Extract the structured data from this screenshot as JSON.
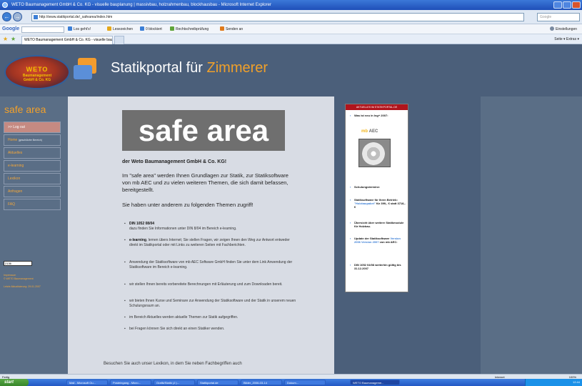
{
  "window": {
    "title": "WETO Baumanagement GmbH & Co. KG - visuelle bauplanung | massivbau, holzrahmenbau, blockhausbau - Microsoft Internet Explorer"
  },
  "browser": {
    "url": "http://www.statikportal.de/_safearea/index.htm",
    "search_placeholder": "Google",
    "tab_title": "WETO Baumanagement GmbH & Co. KG - visuelle bau...",
    "tab_commands": "Seite ▾   Extras ▾",
    "google_logo": "Google",
    "google_items": [
      "Los geht's!",
      "Lesezeichen",
      "0 blockiert",
      "Rechtschreibprüfung",
      "Senden an"
    ],
    "google_settings": "Einstellungen",
    "status_left": "Fertig",
    "status_zone": "Internet",
    "status_zoom": "100%"
  },
  "site": {
    "logo_main": "WETO",
    "logo_sub1": "Baumanagement",
    "logo_sub2": "GmbH & Co. KG",
    "title_prefix": "Statikportal für",
    "title_accent": "Zimmerer",
    "accent_color": "#f0a02a"
  },
  "sidebar": {
    "title": "safe area",
    "items": [
      {
        "label": ">> Log out"
      },
      {
        "label": "Home",
        "note": "(geschützter Bereich)"
      },
      {
        "label": "Aktuelles"
      },
      {
        "label": "e-learning"
      },
      {
        "label": "Lexikon"
      },
      {
        "label": "Anfragen"
      },
      {
        "label": "FAQ"
      }
    ],
    "field_value": "2136",
    "note1": "Impressum",
    "note2": "© WETO Baumanagement",
    "note3": "Letzte Aktualisierung: 29.01.2007"
  },
  "content": {
    "banner": "safe area",
    "company": "der Weto Baumanagement GmbH & Co. KG!",
    "intro": "Im \"safe area\" werden Ihnen Grundlagen zur Statik, zur Statiksoftware von mb AEC und zu vielen weiteren Themen, die sich damit befassen, bereitgestellt.",
    "lead": "Sie haben unter anderem zu folgenden Themen zugriff!",
    "bullets": [
      {
        "strong": "DIN 1052 08/04",
        "text": "dazu finden Sie Informationen unter DIN 8/04 im Bereich e-learning."
      },
      {
        "strong": "e-learning",
        "text": ", lernen übers Internet; Sie stellen Fragen, wir zeigen Ihnen den Weg zur Antwort entweder direkt im Statikportal oder mit Links zu weiteren Seiten mit Fachberichten."
      },
      {
        "strong": "",
        "text": "Anwendung der Statiksoftware von mb AEC Software GmbH finden Sie unter dem Link Anwendung der Statiksoftware im Bereich e-learning."
      },
      {
        "strong": "",
        "text": "wir stellen Ihnen bereits vorbereitete Berechnungen mit Erläuterung und zum Downloaden bereit."
      },
      {
        "strong": "",
        "text": "wir bieten Ihnen Kurse und Seminare zur Anwendung der Statiksoftware und der Statik in unserem neuen Schulungsraum an."
      },
      {
        "strong": "",
        "text": "im Bereich Aktuelles werden aktuelle Themen zur Statik aufgegriffen."
      },
      {
        "strong": "",
        "text": "bei Fragen können Sie sich direkt an einen Statiker wenden."
      }
    ],
    "footer": "Besuchen Sie auch unser Lexikon, in dem Sie neben Fachbegriffen auch"
  },
  "news": {
    "header": "AKTUELLES IM STATIKPORTAL.DE",
    "item1": "Was ist neu in Ing+ 2007:",
    "aec_logo_a": "mb",
    "aec_logo_b": "AEC",
    "item2": "Schulungstermine:",
    "item3a": "Statiksoftware für Ihren Betrieb: ",
    "item3b": "\"Holzbaupaket\"",
    "item3c": " für 399,- € statt 3718,- €",
    "item4": "Übersicht über weitere Statikmodule für Holzbau.",
    "item5a": "Update der Statiksoftware ",
    "item5b": "Version 2006 Version 2007",
    "item5c": " von mb AEC:",
    "item6": "DIN 1052 04/08 weiterhin gültig bis 31.12.2007"
  },
  "taskbar": {
    "start": "start",
    "tasks": [
      "Mail - Microsoft Ou...",
      "Posteingang - Micro...",
      "Grafik/Statik (J:)...",
      "Statikportal.de",
      "Bilder_2006-03-14",
      "Dokum...",
      "WETO Baumanageme..."
    ],
    "clock": "12:44"
  }
}
